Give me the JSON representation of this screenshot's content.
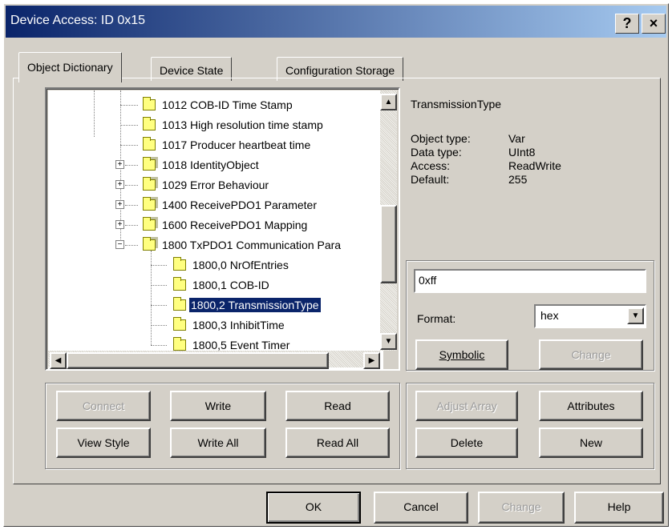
{
  "window": {
    "title": "Device Access: ID 0x15",
    "help_label": "?",
    "close_label": "×"
  },
  "tabs": [
    {
      "label": "Object Dictionary"
    },
    {
      "label": "Device State"
    },
    {
      "label": "Configuration Storage"
    }
  ],
  "tree": {
    "items": [
      {
        "label": "1012 COB-ID Time Stamp"
      },
      {
        "label": "1013 High resolution time stamp"
      },
      {
        "label": "1017 Producer heartbeat time"
      },
      {
        "label": "1018 IdentityObject"
      },
      {
        "label": "1029 Error Behaviour"
      },
      {
        "label": "1400 ReceivePDO1 Parameter"
      },
      {
        "label": "1600 ReceivePDO1 Mapping"
      },
      {
        "label": "1800 TxPDO1 Communication Para"
      },
      {
        "label": "1800,0 NrOfEntries"
      },
      {
        "label": "1800,1 COB-ID"
      },
      {
        "label": "1800,2 TransmissionType"
      },
      {
        "label": "1800,3 InhibitTime"
      },
      {
        "label": "1800,5 Event Timer"
      }
    ],
    "expand_plus": "+",
    "expand_minus": "−"
  },
  "details": {
    "name": "TransmissionType",
    "object_type_label": "Object type:",
    "object_type": "Var",
    "data_type_label": "Data type:",
    "data_type": "UInt8",
    "access_label": "Access:",
    "access": "ReadWrite",
    "default_label": "Default:",
    "default": "255"
  },
  "value_editor": {
    "value": "0xff",
    "format_label": "Format:",
    "format_selected": "hex",
    "symbolic_label": "Symbolic",
    "change_label": "Change"
  },
  "left_buttons": {
    "connect": "Connect",
    "write": "Write",
    "read": "Read",
    "view_style": "View Style",
    "write_all": "Write All",
    "read_all": "Read All"
  },
  "right_buttons": {
    "adjust_array": "Adjust Array",
    "attributes": "Attributes",
    "delete": "Delete",
    "new": "New"
  },
  "footer": {
    "ok": "OK",
    "cancel": "Cancel",
    "change": "Change",
    "help": "Help"
  },
  "scroll": {
    "up": "▲",
    "down": "▼",
    "left": "◀",
    "right": "▶"
  },
  "colors": {
    "title_start": "#0a246a",
    "title_end": "#a6caf0",
    "face": "#d4d0c8",
    "selection": "#0a246a"
  }
}
